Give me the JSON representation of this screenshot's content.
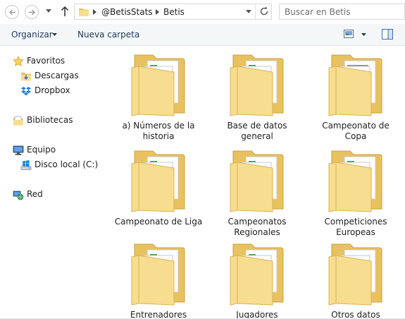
{
  "address_bar": {
    "breadcrumbs": [
      "@BetisStats",
      "Betis"
    ],
    "search_placeholder": "Buscar en Betis"
  },
  "command_bar": {
    "organize_label": "Organizar",
    "new_folder_label": "Nueva carpeta"
  },
  "nav_pane": {
    "favorites": {
      "label": "Favoritos",
      "items": [
        "Descargas",
        "Dropbox"
      ]
    },
    "libraries": {
      "label": "Bibliotecas"
    },
    "computer": {
      "label": "Equipo",
      "items": [
        "Disco local (C:)"
      ]
    },
    "network": {
      "label": "Red"
    }
  },
  "folders": [
    {
      "name": "a) Números de la historia",
      "icon": "folder-spreadsheet-icon"
    },
    {
      "name": "Base de datos general",
      "icon": "folder-spreadsheet-icon"
    },
    {
      "name": "Campeonato de Copa",
      "icon": "folder-document-icon"
    },
    {
      "name": "Campeonato de Liga",
      "icon": "folder-spreadsheet-icon"
    },
    {
      "name": "Campeonatos Regionales",
      "icon": "folder-spreadsheet-icon"
    },
    {
      "name": "Competiciones Europeas",
      "icon": "folder-spreadsheet-icon"
    },
    {
      "name": "Entrenadores",
      "icon": "folder-spreadsheet-icon"
    },
    {
      "name": "Jugadores",
      "icon": "folder-spreadsheet-icon"
    },
    {
      "name": "Otros datos",
      "icon": "folder-document-icon"
    }
  ],
  "colors": {
    "folder_back": "#e8c160",
    "folder_front": "#f7dd8f",
    "sheet_green": "#3c9a5f",
    "accent_text": "#1e3a5f"
  }
}
